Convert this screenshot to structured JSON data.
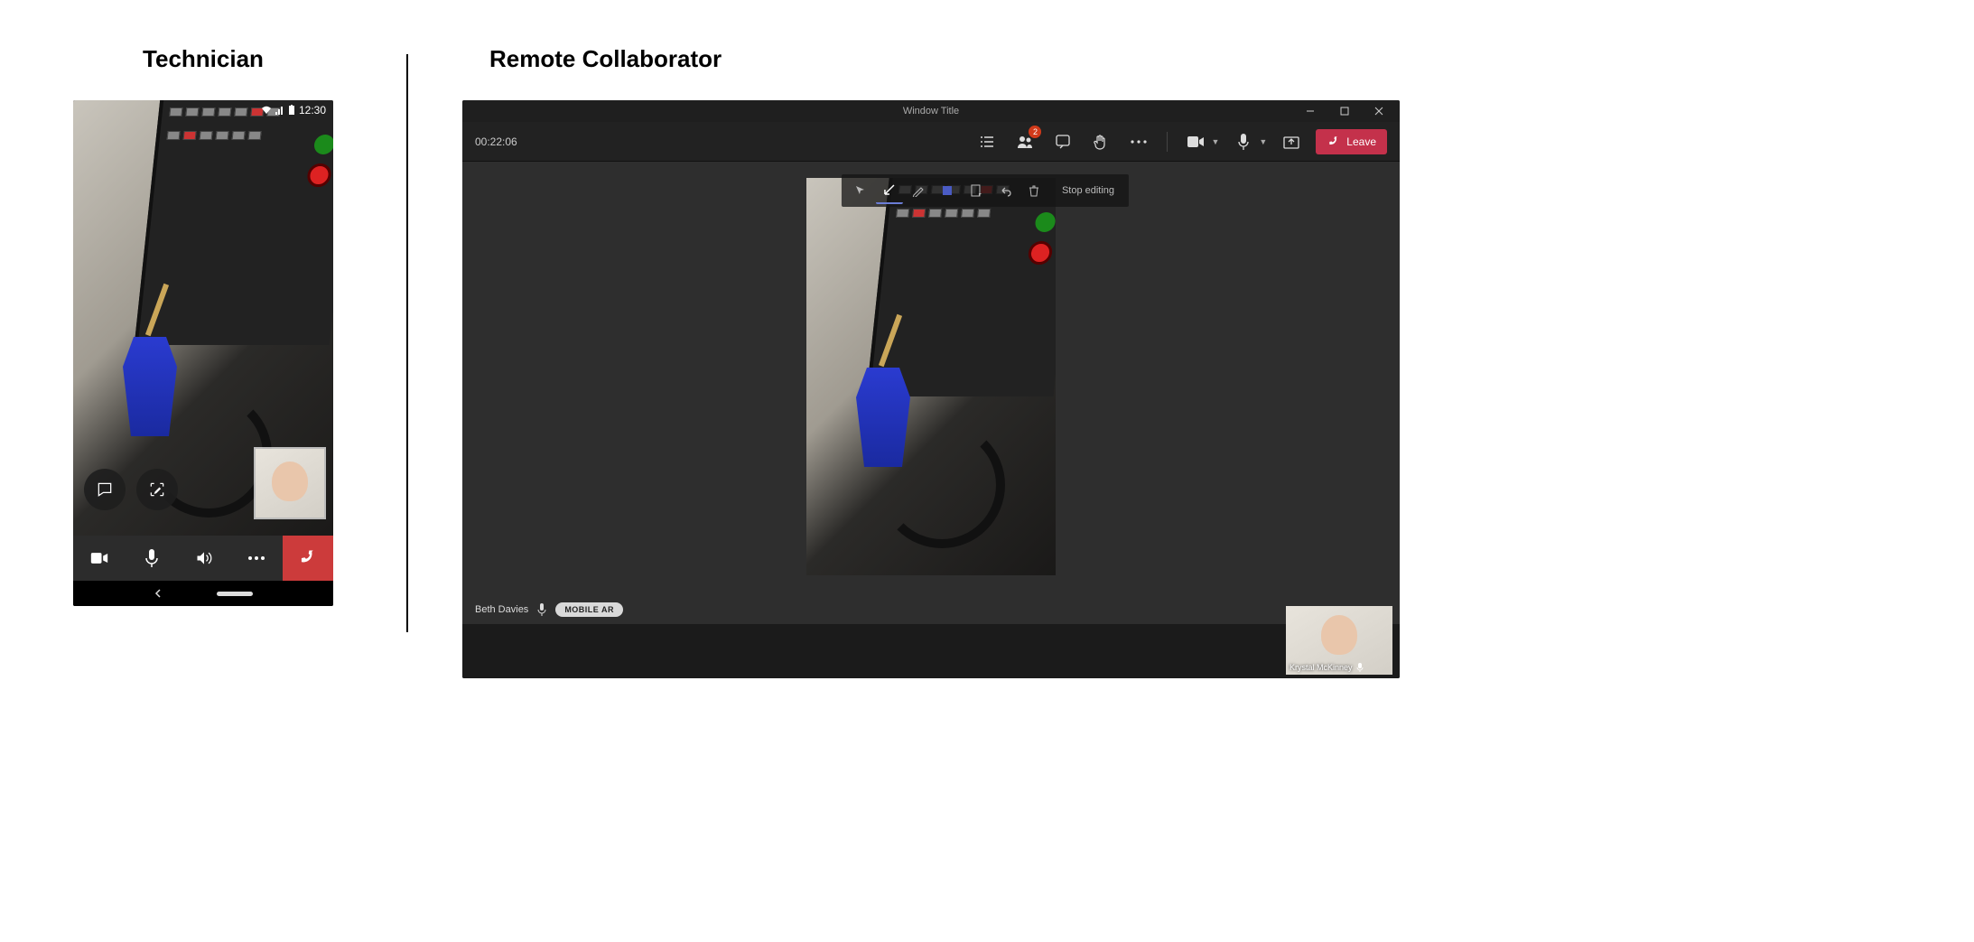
{
  "technician": {
    "title": "Technician",
    "status_time": "12:30",
    "bottom_bar": {
      "video": "video",
      "mic": "mic",
      "speaker": "speaker",
      "more": "more",
      "hangup": "hangup"
    },
    "float_buttons": {
      "chat": "chat",
      "annotate": "annotate"
    }
  },
  "collaborator": {
    "title": "Remote Collaborator",
    "window_title": "Window Title",
    "call_timer": "00:22:06",
    "people_badge": "2",
    "leave_label": "Leave",
    "annotation": {
      "stop_editing": "Stop editing"
    },
    "presenter": {
      "name": "Beth Davies",
      "mode_badge": "MOBILE AR"
    },
    "self_pip": {
      "name": "Krystal McKinney"
    }
  }
}
